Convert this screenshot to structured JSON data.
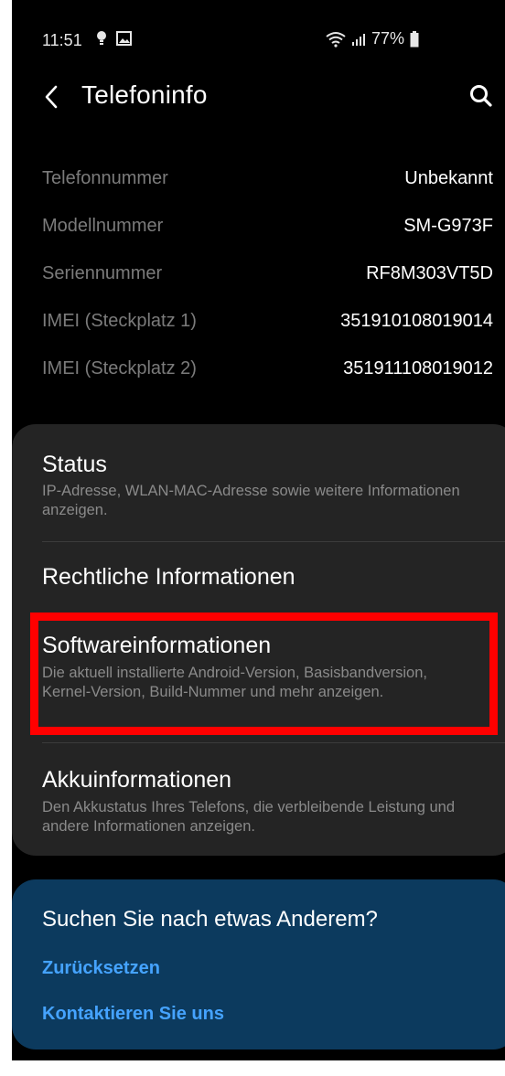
{
  "status_bar": {
    "time": "11:51",
    "battery": "77%",
    "icons": [
      "notification-icon",
      "image-icon",
      "wifi-icon",
      "signal-icon",
      "battery-icon"
    ]
  },
  "header": {
    "title": "Telefoninfo",
    "back_icon": "back-arrow-icon",
    "search_icon": "search-icon"
  },
  "info": [
    {
      "label": "Telefonnummer",
      "value": "Unbekannt"
    },
    {
      "label": "Modellnummer",
      "value": "SM-G973F"
    },
    {
      "label": "Seriennummer",
      "value": "RF8M303VT5D"
    },
    {
      "label": "IMEI (Steckplatz 1)",
      "value": "351910108019014"
    },
    {
      "label": "IMEI (Steckplatz 2)",
      "value": "351911108019012"
    }
  ],
  "menu": [
    {
      "title": "Status",
      "description": "IP-Adresse, WLAN-MAC-Adresse sowie weitere Informationen anzeigen."
    },
    {
      "title": "Rechtliche Informationen",
      "description": ""
    },
    {
      "title": "Softwareinformationen",
      "description": "Die aktuell installierte Android-Version, Basisbandversion, Kernel-Version, Build-Nummer und mehr anzeigen."
    },
    {
      "title": "Akkuinformationen",
      "description": "Den Akkustatus Ihres Telefons, die verbleibende Leistung und andere Informationen anzeigen."
    }
  ],
  "suggestions": {
    "title": "Suchen Sie nach etwas Anderem?",
    "links": [
      "Zurücksetzen",
      "Kontaktieren Sie uns"
    ]
  },
  "colors": {
    "background": "#000000",
    "card": "#242424",
    "suggest_card": "#0c3a5e",
    "link": "#45a3ff",
    "highlight": "#ff0000",
    "label_text": "#7b7b7b"
  }
}
